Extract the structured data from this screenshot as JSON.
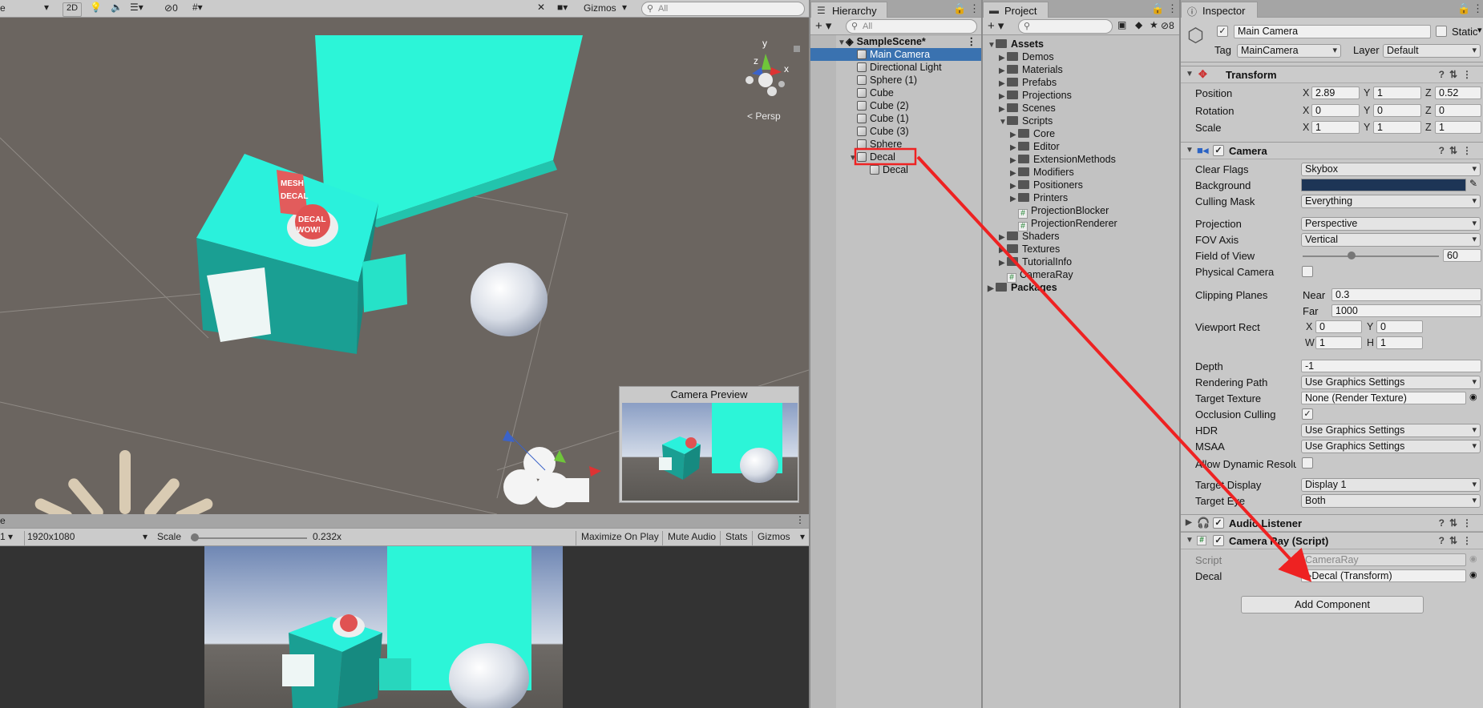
{
  "scene": {
    "toolbar": {
      "btn_2d": "2D",
      "hidden_count": "0",
      "gizmos": "Gizmos",
      "search_placeholder": "All"
    },
    "persp": "< Persp",
    "axis": {
      "x": "x",
      "y": "y",
      "z": "z"
    },
    "camera_preview_title": "Camera Preview",
    "decal_text": {
      "mesh": "MESH",
      "decal": "DECAL",
      "decal2": "DECAL",
      "wow": "WOW!"
    }
  },
  "game": {
    "display": "1",
    "resolution": "1920x1080",
    "scale_label": "Scale",
    "scale_value": "0.232x",
    "maximize": "Maximize On Play",
    "mute": "Mute Audio",
    "stats": "Stats",
    "gizmos": "Gizmos"
  },
  "hierarchy": {
    "tab": "Hierarchy",
    "add": "+",
    "search_placeholder": "All",
    "scene_name": "SampleScene*",
    "items": [
      {
        "label": "Main Camera"
      },
      {
        "label": "Directional Light"
      },
      {
        "label": "Sphere (1)"
      },
      {
        "label": "Cube"
      },
      {
        "label": "Cube (2)"
      },
      {
        "label": "Cube (1)"
      },
      {
        "label": "Cube (3)"
      },
      {
        "label": "Sphere"
      },
      {
        "label": "Decal"
      },
      {
        "label": "Decal"
      }
    ]
  },
  "project": {
    "tab": "Project",
    "add": "+",
    "hidden_count": "8",
    "items": [
      {
        "label": "Assets"
      },
      {
        "label": "Demos"
      },
      {
        "label": "Materials"
      },
      {
        "label": "Prefabs"
      },
      {
        "label": "Projections"
      },
      {
        "label": "Scenes"
      },
      {
        "label": "Scripts"
      },
      {
        "label": "Core"
      },
      {
        "label": "Editor"
      },
      {
        "label": "ExtensionMethods"
      },
      {
        "label": "Modifiers"
      },
      {
        "label": "Positioners"
      },
      {
        "label": "Printers"
      },
      {
        "label": "ProjectionBlocker"
      },
      {
        "label": "ProjectionRenderer"
      },
      {
        "label": "Shaders"
      },
      {
        "label": "Textures"
      },
      {
        "label": "TutorialInfo"
      },
      {
        "label": "CameraRay"
      },
      {
        "label": "Packages"
      }
    ]
  },
  "inspector": {
    "tab": "Inspector",
    "object_name": "Main Camera",
    "static_label": "Static",
    "tag_label": "Tag",
    "tag_value": "MainCamera",
    "layer_label": "Layer",
    "layer_value": "Default",
    "transform": {
      "title": "Transform",
      "position_label": "Position",
      "pos_x": "2.89",
      "pos_y": "1",
      "pos_z": "0.52",
      "rotation_label": "Rotation",
      "rot_x": "0",
      "rot_y": "0",
      "rot_z": "0",
      "scale_label": "Scale",
      "scl_x": "1",
      "scl_y": "1",
      "scl_z": "1"
    },
    "camera": {
      "title": "Camera",
      "clear_flags_label": "Clear Flags",
      "clear_flags": "Skybox",
      "background_label": "Background",
      "background_color": "#1d3556",
      "culling_mask_label": "Culling Mask",
      "culling_mask": "Everything",
      "projection_label": "Projection",
      "projection": "Perspective",
      "fov_axis_label": "FOV Axis",
      "fov_axis": "Vertical",
      "fov_label": "Field of View",
      "fov": "60",
      "fov_fraction": 0.35,
      "physical_label": "Physical Camera",
      "clipping_label": "Clipping Planes",
      "near_label": "Near",
      "near": "0.3",
      "far_label": "Far",
      "far": "1000",
      "viewport_label": "Viewport Rect",
      "vx": "0",
      "vy": "0",
      "vw": "1",
      "vh": "1",
      "depth_label": "Depth",
      "depth": "-1",
      "rendering_path_label": "Rendering Path",
      "rendering_path": "Use Graphics Settings",
      "target_texture_label": "Target Texture",
      "target_texture": "None (Render Texture)",
      "occlusion_label": "Occlusion Culling",
      "hdr_label": "HDR",
      "hdr": "Use Graphics Settings",
      "msaa_label": "MSAA",
      "msaa": "Use Graphics Settings",
      "dynres_label": "Allow Dynamic Resoluti",
      "target_display_label": "Target Display",
      "target_display": "Display 1",
      "target_eye_label": "Target Eye",
      "target_eye": "Both"
    },
    "audio_listener": {
      "title": "Audio Listener"
    },
    "camera_ray": {
      "title": "Camera Ray (Script)",
      "script_label": "Script",
      "script": "CameraRay",
      "decal_label": "Decal",
      "decal": "Decal (Transform)"
    },
    "add_component": "Add Component"
  },
  "annotation_color": "#ee2222"
}
